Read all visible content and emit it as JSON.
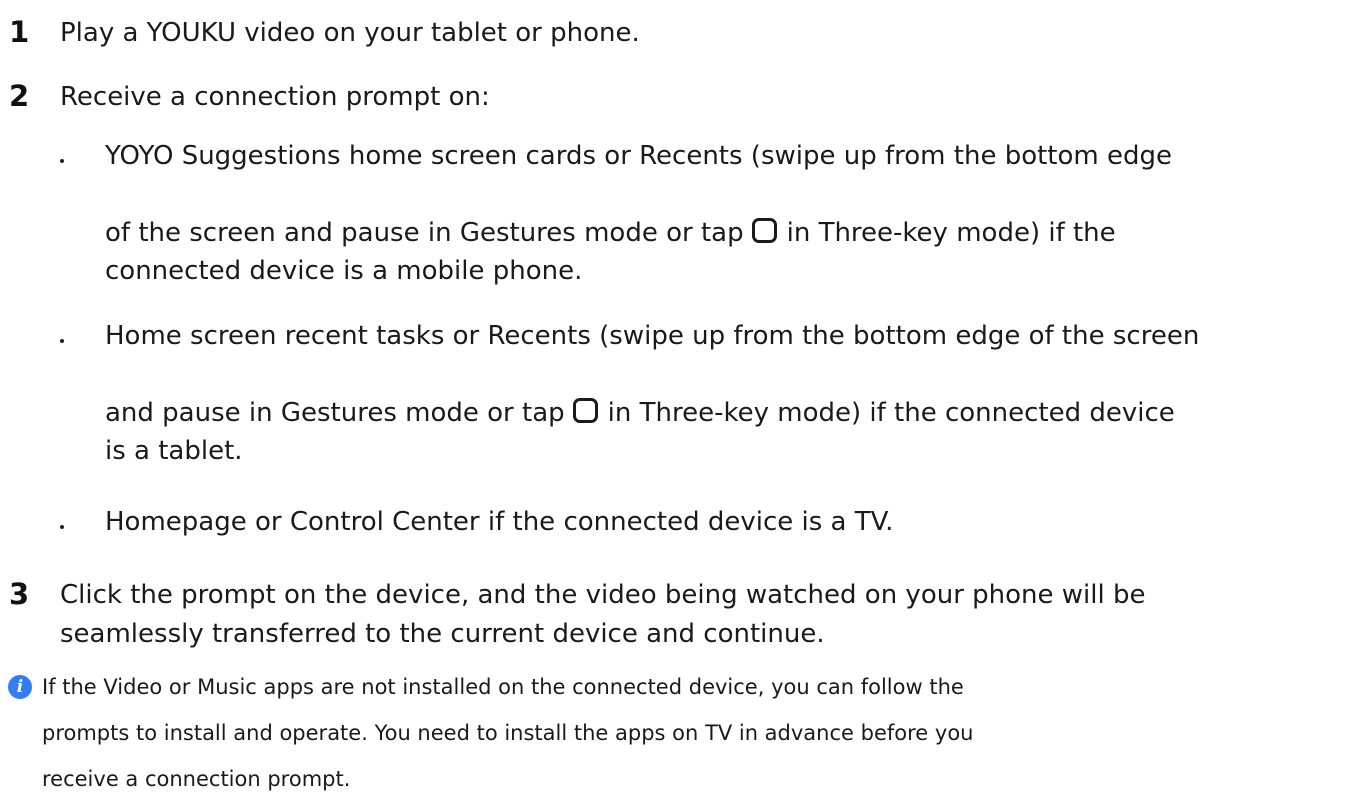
{
  "steps": [
    {
      "num": "1",
      "text": "Play a YOUKU video on your tablet or phone."
    },
    {
      "num": "2",
      "text": "Receive a connection prompt on:"
    },
    {
      "num": "3",
      "lines": [
        "Click the prompt on the device, and the video being watched on your phone will be",
        "seamlessly transferred to the current device and continue."
      ]
    }
  ],
  "bullets": [
    {
      "line1": "YOYO Suggestions home screen cards or Recents (swipe up from the bottom edge",
      "line2_before": "of the screen and pause in Gestures mode or tap",
      "line2_after": "in Three-key mode) if the",
      "line3": "connected device is a mobile phone."
    },
    {
      "line1": "Home screen recent tasks or Recents (swipe up from the bottom edge of the screen",
      "line2_before": "and pause in Gestures mode or tap",
      "line2_after": "in Three-key mode) if the connected device",
      "line3": "is a tablet."
    },
    {
      "line1": "Homepage or Control Center if the connected device is a TV."
    }
  ],
  "note": {
    "icon": "info-icon",
    "lines": [
      "If the Video or Music apps are not installed on the connected device, you can follow the",
      "prompts to install and operate. You need to install the apps on TV in advance before you",
      "receive a connection prompt."
    ]
  },
  "colors": {
    "info_icon": "#2f7ff2",
    "text": "#1a1a1a"
  }
}
